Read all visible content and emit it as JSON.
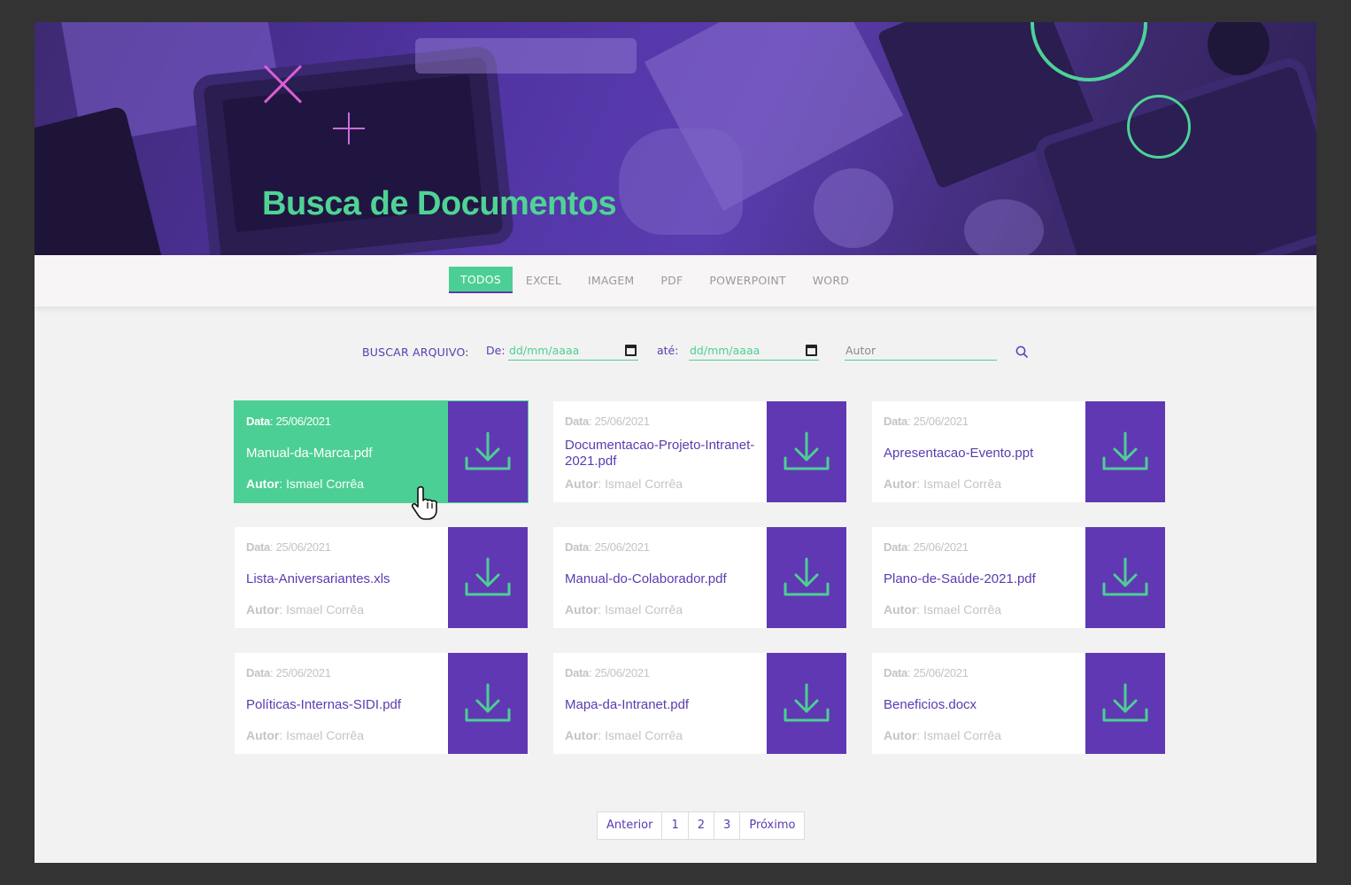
{
  "hero": {
    "title_light": "Busca de ",
    "title_bold": "Documentos"
  },
  "tabs": [
    {
      "label": "TODOS",
      "active": true
    },
    {
      "label": "EXCEL",
      "active": false
    },
    {
      "label": "IMAGEM",
      "active": false
    },
    {
      "label": "PDF",
      "active": false
    },
    {
      "label": "POWERPOINT",
      "active": false
    },
    {
      "label": "WORD",
      "active": false
    }
  ],
  "search": {
    "label": "BUSCAR ARQUIVO:",
    "from_label": "De:",
    "from_placeholder": "dd/mm/aaaa",
    "to_label": "até:",
    "to_placeholder": "dd/mm/aaaa",
    "author_placeholder": "Autor"
  },
  "cards": [
    {
      "date_label": "Data",
      "date": ": 25/06/2021",
      "filename": "Manual-da-Marca.pdf",
      "author_label": "Autor",
      "author": ": Ismael Corrêa",
      "active": true
    },
    {
      "date_label": "Data",
      "date": ": 25/06/2021",
      "filename": "Documentacao-Projeto-Intranet-2021.pdf",
      "author_label": "Autor",
      "author": ": Ismael Corrêa",
      "active": false
    },
    {
      "date_label": "Data",
      "date": ": 25/06/2021",
      "filename": "Apresentacao-Evento.ppt",
      "author_label": "Autor",
      "author": ": Ismael Corrêa",
      "active": false
    },
    {
      "date_label": "Data",
      "date": ": 25/06/2021",
      "filename": "Lista-Aniversariantes.xls",
      "author_label": "Autor",
      "author": ": Ismael Corrêa",
      "active": false
    },
    {
      "date_label": "Data",
      "date": ": 25/06/2021",
      "filename": "Manual-do-Colaborador.pdf",
      "author_label": "Autor",
      "author": ": Ismael Corrêa",
      "active": false
    },
    {
      "date_label": "Data",
      "date": ": 25/06/2021",
      "filename": "Plano-de-Saúde-2021.pdf",
      "author_label": "Autor",
      "author": ": Ismael Corrêa",
      "active": false
    },
    {
      "date_label": "Data",
      "date": ": 25/06/2021",
      "filename": "Políticas-Internas-SIDI.pdf",
      "author_label": "Autor",
      "author": ": Ismael Corrêa",
      "active": false
    },
    {
      "date_label": "Data",
      "date": ": 25/06/2021",
      "filename": "Mapa-da-Intranet.pdf",
      "author_label": "Autor",
      "author": ": Ismael Corrêa",
      "active": false
    },
    {
      "date_label": "Data",
      "date": ": 25/06/2021",
      "filename": "Beneficios.docx",
      "author_label": "Autor",
      "author": ": Ismael Corrêa",
      "active": false
    }
  ],
  "pagination": {
    "prev": "Anterior",
    "pages": [
      "1",
      "2",
      "3"
    ],
    "next": "Próximo"
  },
  "icons": {
    "download": "download-icon",
    "calendar": "calendar-icon",
    "search": "search-icon",
    "cursor": "hand-pointer-icon"
  },
  "colors": {
    "brand_purple": "#6038b4",
    "accent_green": "#4ccf94",
    "text_purple": "#5a3cb0"
  }
}
